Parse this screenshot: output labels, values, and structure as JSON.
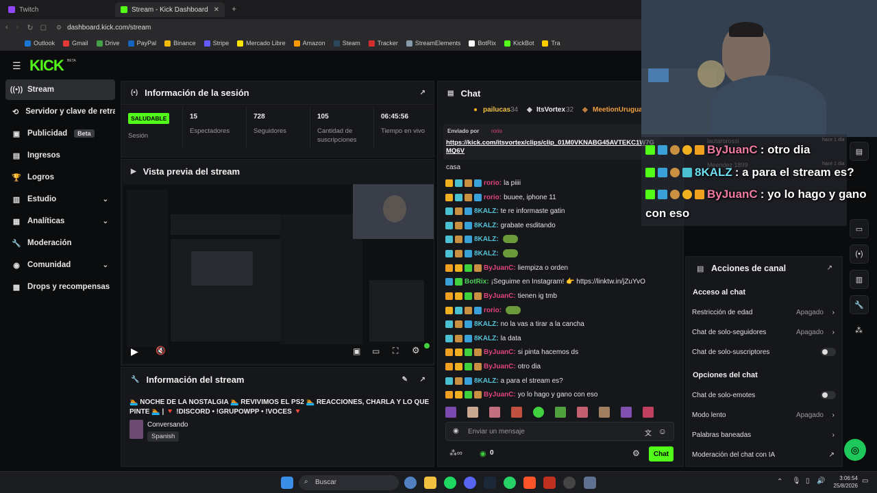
{
  "browser": {
    "tabs": [
      {
        "label": "Twitch"
      },
      {
        "label": "Stream - Kick Dashboard"
      }
    ],
    "url": "dashboard.kick.com/stream",
    "bookmarks": [
      "Outlook",
      "Gmail",
      "Drive",
      "PayPal",
      "Binance",
      "Stripe",
      "Mercado Libre",
      "Amazon",
      "Steam",
      "Tracker",
      "StreamElements",
      "BotRix",
      "KickBot",
      "Tra"
    ]
  },
  "app": {
    "logo": "KICK",
    "logo_sup": "BETA"
  },
  "sidebar": {
    "items": [
      {
        "label": "Stream"
      },
      {
        "label": "Servidor y clave de retransmisión"
      },
      {
        "label": "Publicidad",
        "badge": "Beta"
      },
      {
        "label": "Ingresos"
      },
      {
        "label": "Logros"
      },
      {
        "label": "Estudio"
      },
      {
        "label": "Analíticas"
      },
      {
        "label": "Moderación"
      },
      {
        "label": "Comunidad"
      },
      {
        "label": "Drops y recompensas"
      }
    ]
  },
  "session": {
    "title": "Información de la sesión",
    "status_badge": "SALUDABLE",
    "status_label": "Sesión",
    "stats": [
      {
        "value": "15",
        "label": "Espectadores"
      },
      {
        "value": "728",
        "label": "Seguidores"
      },
      {
        "value": "105",
        "label": "Cantidad de suscripciones"
      },
      {
        "value": "06:45:56",
        "label": "Tiempo en vivo"
      }
    ]
  },
  "preview": {
    "title": "Vista previa del stream"
  },
  "stream_info": {
    "title": "Información del stream",
    "stream_title": "🏊 NOCHE DE LA NOSTALGIA 🏊 REVIVIMOS EL PS2 🏊 REACCIONES, CHARLA Y LO QUE PINTE 🏊 | 🔻 !DISCORD • !GRUPOWPP • !VOCES 🔻",
    "category": "Conversando",
    "language": "Spanish"
  },
  "chat": {
    "title": "Chat",
    "top": [
      {
        "name": "pailucas",
        "count": "34"
      },
      {
        "name": "ItsVortex",
        "count": "32"
      },
      {
        "name": "MeetionUruguay",
        "count": ""
      }
    ],
    "pinned_by_label": "Enviado por",
    "pinned_by_user": "rorio",
    "pinned_link": "https://kick.com/itsvortex/clips/clip_01M0VKNABG45AVTEKC1W7GMQ6V",
    "fragment": "casa",
    "messages": [
      {
        "user": "rorio",
        "text": "la piiii",
        "color": "#e0457b"
      },
      {
        "user": "rorio",
        "text": "buuee, iphone 11",
        "color": "#e0457b"
      },
      {
        "user": "8KALZ",
        "text": "te re informaste gatin",
        "color": "#53c4d8"
      },
      {
        "user": "8KALZ",
        "text": "grabate esditando",
        "color": "#53c4d8"
      },
      {
        "user": "8KALZ",
        "text": "",
        "color": "#53c4d8"
      },
      {
        "user": "8KALZ",
        "text": "",
        "color": "#53c4d8"
      },
      {
        "user": "ByJuanC",
        "text": "liempiza o orden",
        "color": "#e0457b"
      },
      {
        "user": "BotRix",
        "text": "¡Seguime en Instagram! 👉 https://linktw.in/jZuYvO",
        "color": "#4bd35a"
      },
      {
        "user": "ByJuanC",
        "text": "tienen ig tmb",
        "color": "#e0457b"
      },
      {
        "user": "rorio",
        "text": "",
        "color": "#e0457b"
      },
      {
        "user": "8KALZ",
        "text": "no la vas a tirar a la cancha",
        "color": "#53c4d8"
      },
      {
        "user": "8KALZ",
        "text": "la data",
        "color": "#53c4d8"
      },
      {
        "user": "ByJuanC",
        "text": "si pinta hacemos ds",
        "color": "#e0457b"
      },
      {
        "user": "ByJuanC",
        "text": "otro dia",
        "color": "#e0457b"
      },
      {
        "user": "8KALZ",
        "text": "a para el stream es?",
        "color": "#53c4d8"
      },
      {
        "user": "ByJuanC",
        "text": "yo lo hago y gano con eso",
        "color": "#e0457b"
      }
    ],
    "input_placeholder": "Enviar un mensaje",
    "points": "0",
    "send_label": "Chat"
  },
  "channel_actions": {
    "title": "Acciones de canal",
    "section1": "Acceso al chat",
    "rows1": [
      {
        "label": "Restricción de edad",
        "value": "Apagado"
      },
      {
        "label": "Chat de solo-seguidores",
        "value": "Apagado"
      },
      {
        "label": "Chat de solo-suscriptores",
        "value": ""
      }
    ],
    "section2": "Opciones del chat",
    "rows2": [
      {
        "label": "Chat de solo-emotes",
        "value": ""
      },
      {
        "label": "Modo lento",
        "value": "Apagado"
      },
      {
        "label": "Palabras baneadas",
        "value": ""
      },
      {
        "label": "Moderación del chat con IA",
        "value": ""
      }
    ]
  },
  "overlay": {
    "faded": [
      {
        "name": "lautarorossi",
        "time": "hace 1 día"
      },
      {
        "name": "Meendez 1899",
        "time": "hace 1 día"
      }
    ],
    "messages": [
      {
        "user": "ByJuanC",
        "text": " : otro dia",
        "color": "#f07aa0"
      },
      {
        "user": "8KALZ",
        "text": " : a para el stream es?",
        "color": "#6fe0f0"
      },
      {
        "user": "ByJuanC",
        "text": " : yo lo hago y gano",
        "color": "#f07aa0"
      }
    ],
    "wrap": "con eso"
  },
  "taskbar": {
    "search": "Buscar",
    "time": "3:06:54",
    "date": "25/8/2026"
  }
}
